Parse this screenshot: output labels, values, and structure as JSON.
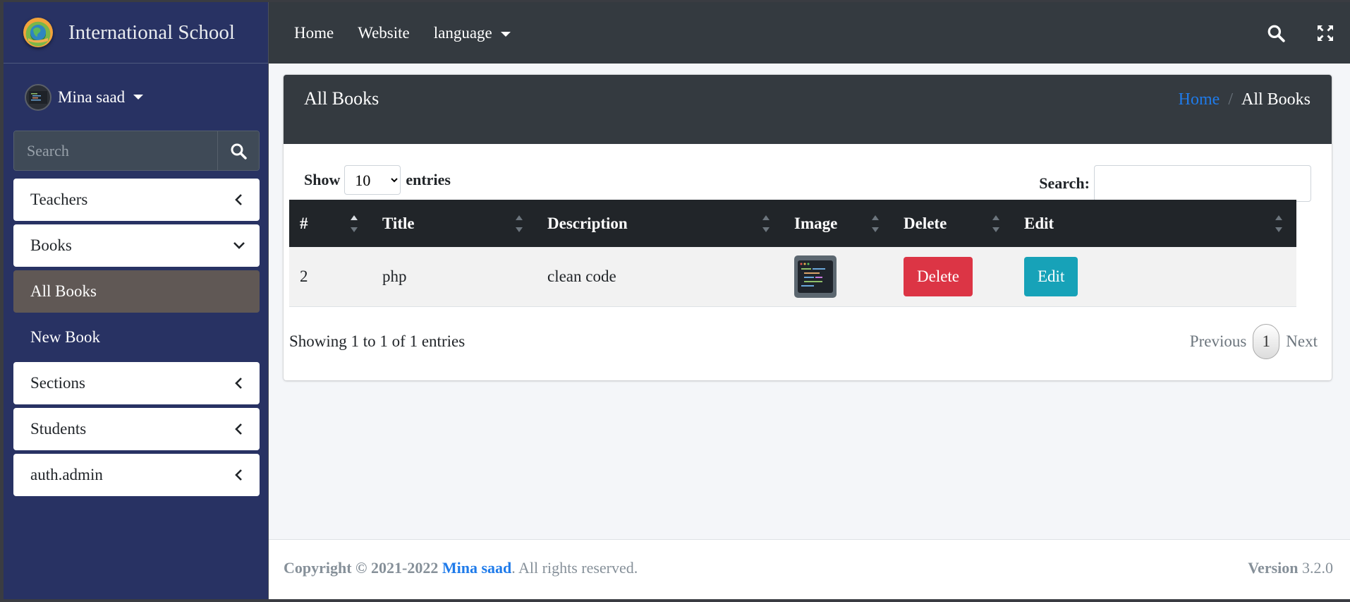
{
  "brand": {
    "title": "International School"
  },
  "user": {
    "name": "Mina saad"
  },
  "sidebar": {
    "search_placeholder": "Search",
    "items": [
      {
        "label": "Teachers"
      },
      {
        "label": "Books"
      },
      {
        "label": "All Books"
      },
      {
        "label": "New Book"
      },
      {
        "label": "Sections"
      },
      {
        "label": "Students"
      },
      {
        "label": "auth.admin"
      }
    ]
  },
  "topnav": {
    "home": "Home",
    "website": "Website",
    "language": "language"
  },
  "page": {
    "title": "All Books",
    "breadcrumb_home": "Home",
    "breadcrumb_sep": "/",
    "breadcrumb_current": "All Books"
  },
  "datatable": {
    "show_label": "Show",
    "entries_label": "entries",
    "page_size": "10",
    "search_label": "Search:",
    "columns": [
      "#",
      "Title",
      "Description",
      "Image",
      "Delete",
      "Edit"
    ],
    "rows": [
      {
        "id": "2",
        "title": "php",
        "description": "clean code",
        "delete_label": "Delete",
        "edit_label": "Edit"
      }
    ],
    "info": "Showing 1 to 1 of 1 entries",
    "previous": "Previous",
    "current_page": "1",
    "next": "Next"
  },
  "footer": {
    "copyright": "Copyright © 2021-2022",
    "author": "Mina saad",
    "rights": ". All rights reserved.",
    "version_label": "Version",
    "version": "3.2.0"
  },
  "colors": {
    "sidebar": "#283263",
    "topbar": "#343a40",
    "link": "#1f7bea",
    "danger": "#dc3545",
    "info": "#17a2b8",
    "active_item": "#605855"
  }
}
